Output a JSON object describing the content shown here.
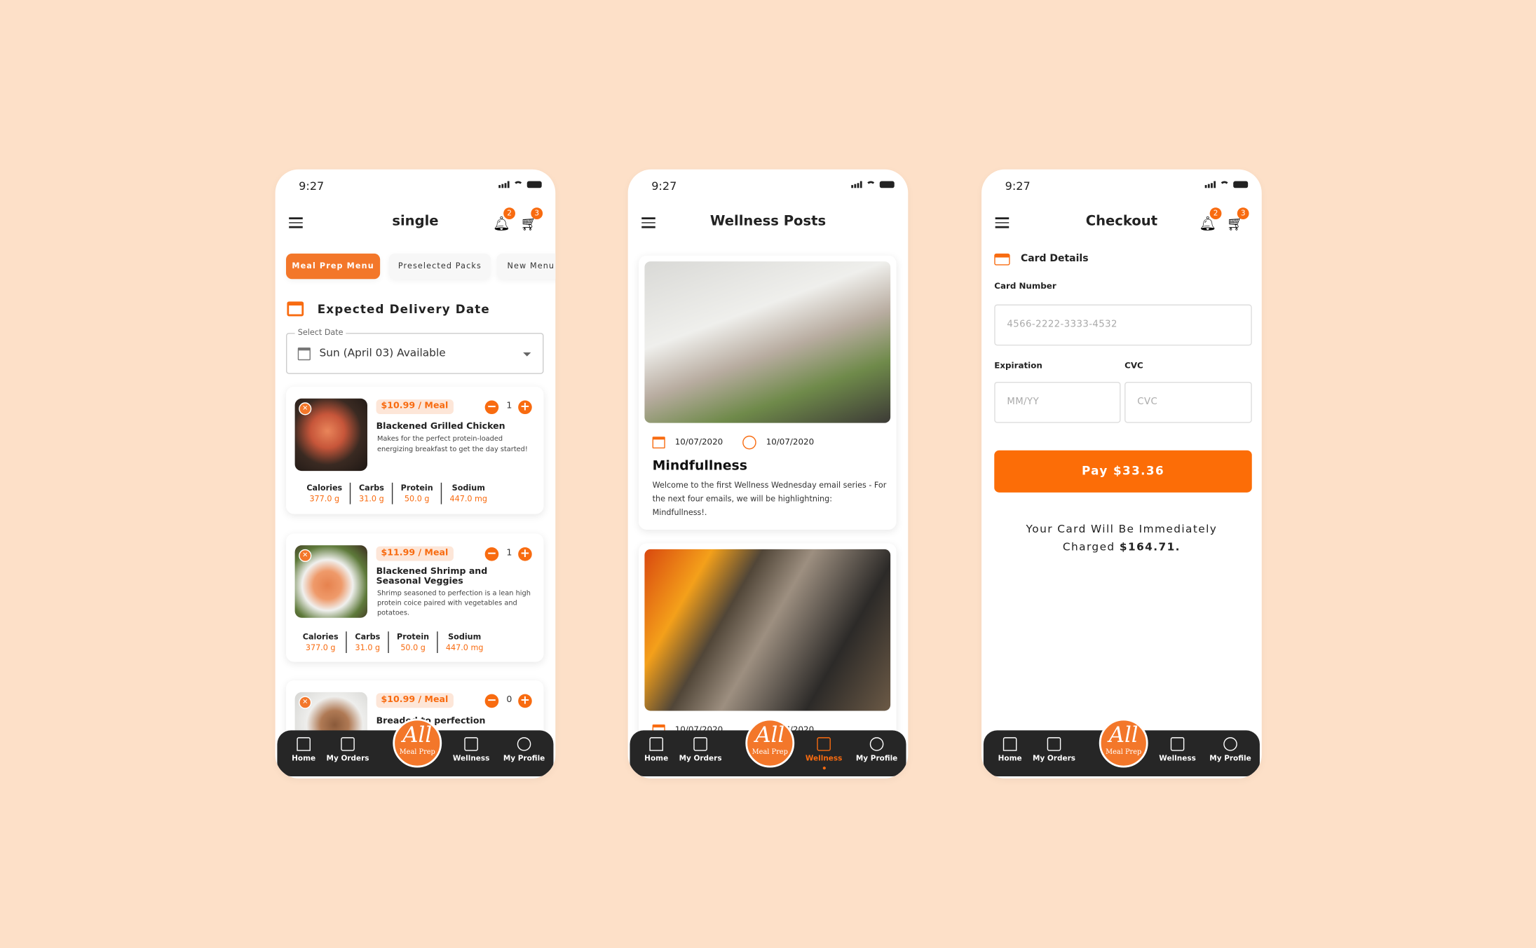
{
  "status": {
    "time": "9:27"
  },
  "badges": {
    "notifications": "2",
    "cart": "3"
  },
  "colors": {
    "accent": "#f86b10",
    "background": "#fde0c8",
    "nav": "#262626"
  },
  "nav": {
    "items": [
      {
        "label": "Home",
        "icon": "home-icon"
      },
      {
        "label": "My Orders",
        "icon": "list-icon"
      },
      {
        "label": "Wellness",
        "icon": "list-icon"
      },
      {
        "label": "My Profile",
        "icon": "user-circle-icon"
      }
    ],
    "logo_main": "All",
    "logo_sub": "Meal Prep"
  },
  "menu_screen": {
    "title": "single",
    "tabs": [
      "Meal Prep Menu",
      "Preselected Packs",
      "New Menu"
    ],
    "active_tab": 0,
    "delivery_heading": "Expected Delivery Date",
    "select_label": "Select Date",
    "select_value": "Sun (April 03) Available",
    "nutrition_labels": [
      "Calories",
      "Carbs",
      "Protein",
      "Sodium"
    ],
    "meals": [
      {
        "price": "$10.99 / Meal",
        "qty": "1",
        "title": "Blackened Grilled Chicken",
        "desc": "Makes for the perfect protein-loaded energizing breakfast to get the day started!",
        "nutrition": [
          "377.0 g",
          "31.0 g",
          "50.0 g",
          "447.0 mg"
        ]
      },
      {
        "price": "$11.99 / Meal",
        "qty": "1",
        "title": "Blackened Shrimp and Seasonal Veggies",
        "desc": "Shrimp seasoned to perfection is a lean high protein coice paired with vegetables and potatoes.",
        "nutrition": [
          "377.0 g",
          "31.0 g",
          "50.0 g",
          "447.0 mg"
        ]
      },
      {
        "price": "$10.99 / Meal",
        "qty": "0",
        "title": "Breaded to perfection"
      }
    ]
  },
  "wellness_screen": {
    "title": "Wellness Posts",
    "active_nav": "Wellness",
    "posts": [
      {
        "date": "10/07/2020",
        "time": "10/07/2020",
        "title": "Mindfullness",
        "body": "Welcome to the first Wellness Wednesday email series - For the next four emails, we will be highlightning: Mindfullness!."
      },
      {
        "date": "10/07/2020",
        "time": "10/07/2020"
      }
    ]
  },
  "checkout_screen": {
    "title": "Checkout",
    "section": "Card Details",
    "card_number_label": "Card Number",
    "card_number_placeholder": "4566-2222-3333-4532",
    "expiration_label": "Expiration",
    "expiration_placeholder": "MM/YY",
    "cvc_label": "CVC",
    "cvc_placeholder": "CVC",
    "pay_button": "Pay $33.36",
    "notice": "Your Card Will Be Immediately Charged",
    "notice_amount": "$164.71."
  }
}
